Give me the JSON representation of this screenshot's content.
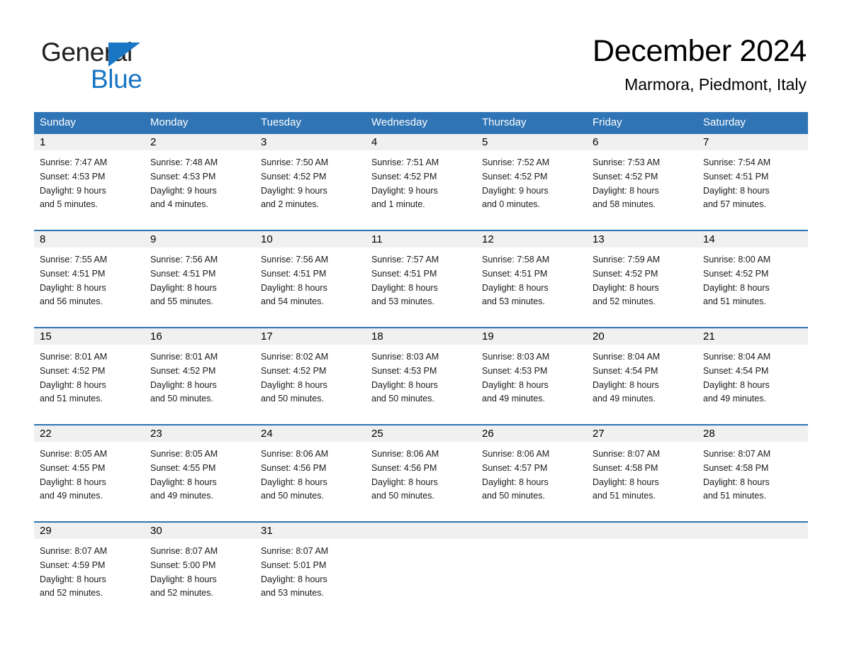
{
  "brand": {
    "name_part1": "General",
    "name_part2": "Blue",
    "triangle_icon": "triangle-icon",
    "color_black": "#221f20",
    "color_blue": "#1876c4"
  },
  "header": {
    "title": "December 2024",
    "location": "Marmora, Piedmont, Italy"
  },
  "theme": {
    "header_blue": "#2f74b5",
    "day_band_gray": "#f0f0f0",
    "separator_blue": "#2f74b5",
    "text_black": "#000000"
  },
  "calendar": {
    "weekdays": [
      "Sunday",
      "Monday",
      "Tuesday",
      "Wednesday",
      "Thursday",
      "Friday",
      "Saturday"
    ],
    "weeks": [
      {
        "days": [
          {
            "number": "1",
            "sunrise": "Sunrise: 7:47 AM",
            "sunset": "Sunset: 4:53 PM",
            "daylight_line1": "Daylight: 9 hours",
            "daylight_line2": "and 5 minutes."
          },
          {
            "number": "2",
            "sunrise": "Sunrise: 7:48 AM",
            "sunset": "Sunset: 4:53 PM",
            "daylight_line1": "Daylight: 9 hours",
            "daylight_line2": "and 4 minutes."
          },
          {
            "number": "3",
            "sunrise": "Sunrise: 7:50 AM",
            "sunset": "Sunset: 4:52 PM",
            "daylight_line1": "Daylight: 9 hours",
            "daylight_line2": "and 2 minutes."
          },
          {
            "number": "4",
            "sunrise": "Sunrise: 7:51 AM",
            "sunset": "Sunset: 4:52 PM",
            "daylight_line1": "Daylight: 9 hours",
            "daylight_line2": "and 1 minute."
          },
          {
            "number": "5",
            "sunrise": "Sunrise: 7:52 AM",
            "sunset": "Sunset: 4:52 PM",
            "daylight_line1": "Daylight: 9 hours",
            "daylight_line2": "and 0 minutes."
          },
          {
            "number": "6",
            "sunrise": "Sunrise: 7:53 AM",
            "sunset": "Sunset: 4:52 PM",
            "daylight_line1": "Daylight: 8 hours",
            "daylight_line2": "and 58 minutes."
          },
          {
            "number": "7",
            "sunrise": "Sunrise: 7:54 AM",
            "sunset": "Sunset: 4:51 PM",
            "daylight_line1": "Daylight: 8 hours",
            "daylight_line2": "and 57 minutes."
          }
        ]
      },
      {
        "days": [
          {
            "number": "8",
            "sunrise": "Sunrise: 7:55 AM",
            "sunset": "Sunset: 4:51 PM",
            "daylight_line1": "Daylight: 8 hours",
            "daylight_line2": "and 56 minutes."
          },
          {
            "number": "9",
            "sunrise": "Sunrise: 7:56 AM",
            "sunset": "Sunset: 4:51 PM",
            "daylight_line1": "Daylight: 8 hours",
            "daylight_line2": "and 55 minutes."
          },
          {
            "number": "10",
            "sunrise": "Sunrise: 7:56 AM",
            "sunset": "Sunset: 4:51 PM",
            "daylight_line1": "Daylight: 8 hours",
            "daylight_line2": "and 54 minutes."
          },
          {
            "number": "11",
            "sunrise": "Sunrise: 7:57 AM",
            "sunset": "Sunset: 4:51 PM",
            "daylight_line1": "Daylight: 8 hours",
            "daylight_line2": "and 53 minutes."
          },
          {
            "number": "12",
            "sunrise": "Sunrise: 7:58 AM",
            "sunset": "Sunset: 4:51 PM",
            "daylight_line1": "Daylight: 8 hours",
            "daylight_line2": "and 53 minutes."
          },
          {
            "number": "13",
            "sunrise": "Sunrise: 7:59 AM",
            "sunset": "Sunset: 4:52 PM",
            "daylight_line1": "Daylight: 8 hours",
            "daylight_line2": "and 52 minutes."
          },
          {
            "number": "14",
            "sunrise": "Sunrise: 8:00 AM",
            "sunset": "Sunset: 4:52 PM",
            "daylight_line1": "Daylight: 8 hours",
            "daylight_line2": "and 51 minutes."
          }
        ]
      },
      {
        "days": [
          {
            "number": "15",
            "sunrise": "Sunrise: 8:01 AM",
            "sunset": "Sunset: 4:52 PM",
            "daylight_line1": "Daylight: 8 hours",
            "daylight_line2": "and 51 minutes."
          },
          {
            "number": "16",
            "sunrise": "Sunrise: 8:01 AM",
            "sunset": "Sunset: 4:52 PM",
            "daylight_line1": "Daylight: 8 hours",
            "daylight_line2": "and 50 minutes."
          },
          {
            "number": "17",
            "sunrise": "Sunrise: 8:02 AM",
            "sunset": "Sunset: 4:52 PM",
            "daylight_line1": "Daylight: 8 hours",
            "daylight_line2": "and 50 minutes."
          },
          {
            "number": "18",
            "sunrise": "Sunrise: 8:03 AM",
            "sunset": "Sunset: 4:53 PM",
            "daylight_line1": "Daylight: 8 hours",
            "daylight_line2": "and 50 minutes."
          },
          {
            "number": "19",
            "sunrise": "Sunrise: 8:03 AM",
            "sunset": "Sunset: 4:53 PM",
            "daylight_line1": "Daylight: 8 hours",
            "daylight_line2": "and 49 minutes."
          },
          {
            "number": "20",
            "sunrise": "Sunrise: 8:04 AM",
            "sunset": "Sunset: 4:54 PM",
            "daylight_line1": "Daylight: 8 hours",
            "daylight_line2": "and 49 minutes."
          },
          {
            "number": "21",
            "sunrise": "Sunrise: 8:04 AM",
            "sunset": "Sunset: 4:54 PM",
            "daylight_line1": "Daylight: 8 hours",
            "daylight_line2": "and 49 minutes."
          }
        ]
      },
      {
        "days": [
          {
            "number": "22",
            "sunrise": "Sunrise: 8:05 AM",
            "sunset": "Sunset: 4:55 PM",
            "daylight_line1": "Daylight: 8 hours",
            "daylight_line2": "and 49 minutes."
          },
          {
            "number": "23",
            "sunrise": "Sunrise: 8:05 AM",
            "sunset": "Sunset: 4:55 PM",
            "daylight_line1": "Daylight: 8 hours",
            "daylight_line2": "and 49 minutes."
          },
          {
            "number": "24",
            "sunrise": "Sunrise: 8:06 AM",
            "sunset": "Sunset: 4:56 PM",
            "daylight_line1": "Daylight: 8 hours",
            "daylight_line2": "and 50 minutes."
          },
          {
            "number": "25",
            "sunrise": "Sunrise: 8:06 AM",
            "sunset": "Sunset: 4:56 PM",
            "daylight_line1": "Daylight: 8 hours",
            "daylight_line2": "and 50 minutes."
          },
          {
            "number": "26",
            "sunrise": "Sunrise: 8:06 AM",
            "sunset": "Sunset: 4:57 PM",
            "daylight_line1": "Daylight: 8 hours",
            "daylight_line2": "and 50 minutes."
          },
          {
            "number": "27",
            "sunrise": "Sunrise: 8:07 AM",
            "sunset": "Sunset: 4:58 PM",
            "daylight_line1": "Daylight: 8 hours",
            "daylight_line2": "and 51 minutes."
          },
          {
            "number": "28",
            "sunrise": "Sunrise: 8:07 AM",
            "sunset": "Sunset: 4:58 PM",
            "daylight_line1": "Daylight: 8 hours",
            "daylight_line2": "and 51 minutes."
          }
        ]
      },
      {
        "days": [
          {
            "number": "29",
            "sunrise": "Sunrise: 8:07 AM",
            "sunset": "Sunset: 4:59 PM",
            "daylight_line1": "Daylight: 8 hours",
            "daylight_line2": "and 52 minutes."
          },
          {
            "number": "30",
            "sunrise": "Sunrise: 8:07 AM",
            "sunset": "Sunset: 5:00 PM",
            "daylight_line1": "Daylight: 8 hours",
            "daylight_line2": "and 52 minutes."
          },
          {
            "number": "31",
            "sunrise": "Sunrise: 8:07 AM",
            "sunset": "Sunset: 5:01 PM",
            "daylight_line1": "Daylight: 8 hours",
            "daylight_line2": "and 53 minutes."
          },
          {
            "number": "",
            "sunrise": "",
            "sunset": "",
            "daylight_line1": "",
            "daylight_line2": ""
          },
          {
            "number": "",
            "sunrise": "",
            "sunset": "",
            "daylight_line1": "",
            "daylight_line2": ""
          },
          {
            "number": "",
            "sunrise": "",
            "sunset": "",
            "daylight_line1": "",
            "daylight_line2": ""
          },
          {
            "number": "",
            "sunrise": "",
            "sunset": "",
            "daylight_line1": "",
            "daylight_line2": ""
          }
        ]
      }
    ]
  }
}
